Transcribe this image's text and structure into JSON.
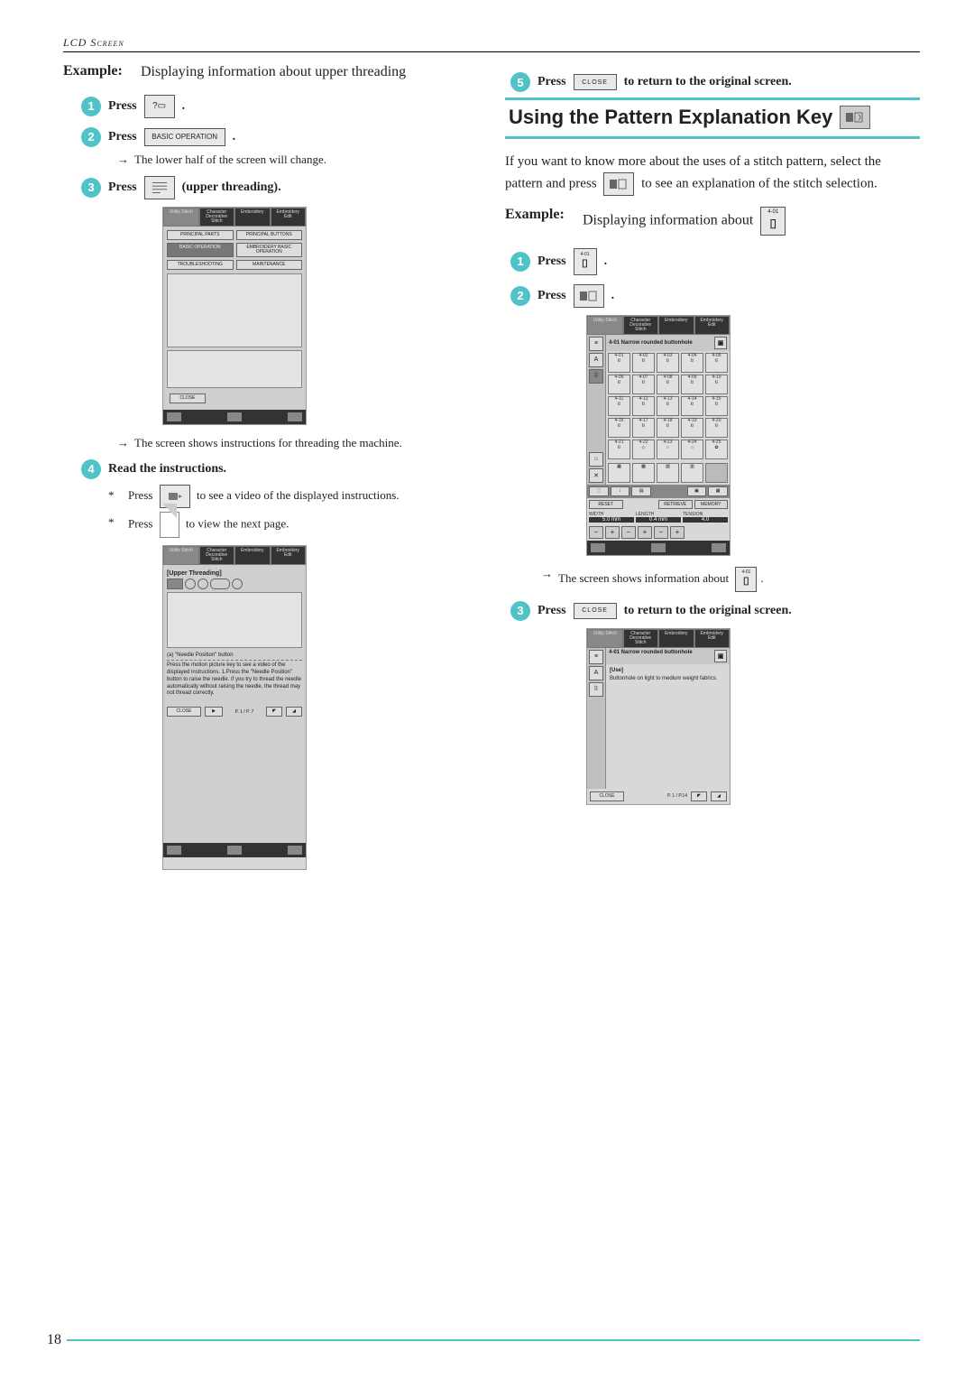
{
  "header": {
    "section": "LCD Screen"
  },
  "left": {
    "example_label": "Example:",
    "example_text": "Displaying information about upper threading",
    "step1": {
      "press": "Press",
      "icon": "?"
    },
    "step2": {
      "press": "Press",
      "icon": "BASIC OPERATION"
    },
    "step2_note": "The lower half of the screen will change.",
    "step3": {
      "press": "Press",
      "suffix": "(upper threading)."
    },
    "lcd1": {
      "tabs": [
        "Utility Stitch",
        "Character Decorative Stitch",
        "Embroidery",
        "Embroidery Edit"
      ],
      "buttons": [
        "PRINCIPAL PARTS",
        "PRINCIPAL BUTTONS",
        "BASIC OPERATION",
        "EMBROIDERY BASIC OPERATION",
        "TROUBLESHOOTING",
        "MAINTENANCE"
      ],
      "close": "CLOSE"
    },
    "step3_note": "The screen shows instructions for threading the machine.",
    "step4": {
      "text": "Read the instructions."
    },
    "bullet_a_pre": "Press",
    "bullet_a_post": "to see a video of the displayed instructions.",
    "bullet_b_pre": "Press",
    "bullet_b_post": "to view the next page.",
    "lcd2": {
      "tabs": [
        "Utility Stitch",
        "Character Decorative Stitch",
        "Embroidery",
        "Embroidery Edit"
      ],
      "title": "[Upper Threading]",
      "caption": "(a)  \"Needle Position\" button",
      "body": "Press the motion picture key to see a video of the displayed instructions. 1.Press the \"Needle Position\" button to raise the needle.  If you try to thread the needle automatically without raising the needle, the thread may not thread correctly.",
      "close": "CLOSE",
      "pages": "P. 1 / P. 7"
    }
  },
  "right": {
    "step5_press": "Press",
    "step5_close": "CLOSE",
    "step5_text": "to return to the original screen.",
    "section_title": "Using the Pattern Explanation Key",
    "intro_a": "If you want to know more about the uses of a stitch pattern, select the pattern and press",
    "intro_b": "to see an explanation of the stitch selection.",
    "example_label": "Example:",
    "example_text": "Displaying information about",
    "example_icon": "4-01",
    "step1": {
      "press": "Press",
      "icon": "4-01"
    },
    "step2": {
      "press": "Press"
    },
    "lcd1": {
      "tabs": [
        "Utility Stitch",
        "Character Decorative Stitch",
        "Embroidery",
        "Embroidery Edit"
      ],
      "title": "4-01 Narrow rounded buttonhole",
      "cells": [
        "4-01",
        "4-02",
        "4-03",
        "4-04",
        "4-05",
        "4-06",
        "4-07",
        "4-08",
        "4-09",
        "4-10",
        "4-11",
        "4-12",
        "4-13",
        "4-14",
        "4-15",
        "4-16",
        "4-17",
        "4-18",
        "4-19",
        "4-20",
        "4-21",
        "4-22",
        "4-23",
        "4-24",
        "4-25"
      ],
      "controls": {
        "retrieve": "RETRIEVE",
        "memory": "MEMORY",
        "reset": "RESET"
      },
      "params": {
        "width": "WIDTH",
        "width_v": "5.0 mm",
        "length": "LENGTH",
        "length_v": "0.4 mm",
        "tension": "TENSION",
        "tension_v": "4.0"
      }
    },
    "step2_note_pre": "The screen shows information about",
    "step3_press": "Press",
    "step3_close": "CLOSE",
    "step3_text": "to return to the original screen.",
    "lcd2": {
      "tabs": [
        "Utility Stitch",
        "Character Decorative Stitch",
        "Embroidery",
        "Embroidery Edit"
      ],
      "title": "4-01 Narrow rounded buttonhole",
      "use_label": "[Use]",
      "use_text": "Buttonhole on light to medium weight fabrics.",
      "close": "CLOSE",
      "pages": "P. 1 / P.14"
    }
  },
  "page_number": "18"
}
